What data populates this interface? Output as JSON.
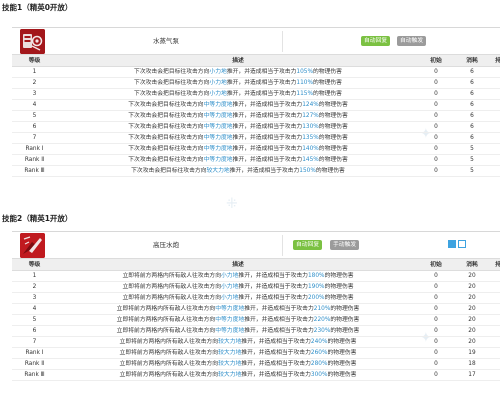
{
  "colors": {
    "auto_recovery": "#7bc142",
    "auto_trigger": "#9b9b9b",
    "manual_trigger": "#9b9b9b",
    "highlight": "#2d8ec9",
    "header_bg": "#efefef",
    "charge_blue": "#3ea3e0"
  },
  "columns": {
    "level": "等级",
    "description": "描述",
    "initial": "初始",
    "cost": "消耗",
    "duration": "持续"
  },
  "skill1": {
    "section_title": "技能1（精英0开放）",
    "icon": "steam-pump-skill-icon",
    "name": "水蒸气泵",
    "tags": [
      "自动回复",
      "自动触发"
    ],
    "desc_prefix": "下次攻击会把目标往攻击方向",
    "desc_middle": "推开，并造成相当于攻击力",
    "desc_suffix": "的物理伤害",
    "rows": [
      {
        "level": "1",
        "force": "小力地",
        "pct": "105%",
        "initial": "0",
        "cost": "6",
        "duration": ""
      },
      {
        "level": "2",
        "force": "小力地",
        "pct": "110%",
        "initial": "0",
        "cost": "6",
        "duration": ""
      },
      {
        "level": "3",
        "force": "小力地",
        "pct": "115%",
        "initial": "0",
        "cost": "6",
        "duration": ""
      },
      {
        "level": "4",
        "force": "中等力度地",
        "pct": "124%",
        "initial": "0",
        "cost": "6",
        "duration": ""
      },
      {
        "level": "5",
        "force": "中等力度地",
        "pct": "127%",
        "initial": "0",
        "cost": "6",
        "duration": ""
      },
      {
        "level": "6",
        "force": "中等力度地",
        "pct": "130%",
        "initial": "0",
        "cost": "6",
        "duration": ""
      },
      {
        "level": "7",
        "force": "中等力度地",
        "pct": "135%",
        "initial": "0",
        "cost": "6",
        "duration": ""
      },
      {
        "level": "Rank Ⅰ",
        "force": "中等力度地",
        "pct": "140%",
        "initial": "0",
        "cost": "5",
        "duration": ""
      },
      {
        "level": "Rank Ⅱ",
        "force": "中等力度地",
        "pct": "145%",
        "initial": "0",
        "cost": "5",
        "duration": ""
      },
      {
        "level": "Rank Ⅲ",
        "force": "较大力地",
        "pct": "150%",
        "initial": "0",
        "cost": "5",
        "duration": ""
      }
    ]
  },
  "skill2": {
    "section_title": "技能2（精英1开放）",
    "icon": "water-cannon-skill-icon",
    "name": "高压水炮",
    "tags": [
      "自动回复",
      "手动触发"
    ],
    "desc_prefix": "立即将前方两格内所有敌人往攻击方向",
    "desc_middle": "推开，并造成相当于攻击力",
    "desc_suffix": "的物理伤害",
    "rows": [
      {
        "level": "1",
        "force": "小力地",
        "pct": "180%",
        "initial": "0",
        "cost": "20",
        "duration": ""
      },
      {
        "level": "2",
        "force": "小力地",
        "pct": "190%",
        "initial": "0",
        "cost": "20",
        "duration": ""
      },
      {
        "level": "3",
        "force": "小力地",
        "pct": "200%",
        "initial": "0",
        "cost": "20",
        "duration": ""
      },
      {
        "level": "4",
        "force": "中等力度地",
        "pct": "210%",
        "initial": "0",
        "cost": "20",
        "duration": ""
      },
      {
        "level": "5",
        "force": "中等力度地",
        "pct": "220%",
        "initial": "0",
        "cost": "20",
        "duration": ""
      },
      {
        "level": "6",
        "force": "中等力度地",
        "pct": "230%",
        "initial": "0",
        "cost": "20",
        "duration": ""
      },
      {
        "level": "7",
        "force": "较大力地",
        "pct": "240%",
        "initial": "0",
        "cost": "20",
        "duration": ""
      },
      {
        "level": "Rank Ⅰ",
        "force": "较大力地",
        "pct": "260%",
        "initial": "0",
        "cost": "19",
        "duration": ""
      },
      {
        "level": "Rank Ⅱ",
        "force": "较大力地",
        "pct": "280%",
        "initial": "0",
        "cost": "18",
        "duration": ""
      },
      {
        "level": "Rank Ⅲ",
        "force": "较大力地",
        "pct": "300%",
        "initial": "0",
        "cost": "17",
        "duration": ""
      }
    ]
  }
}
